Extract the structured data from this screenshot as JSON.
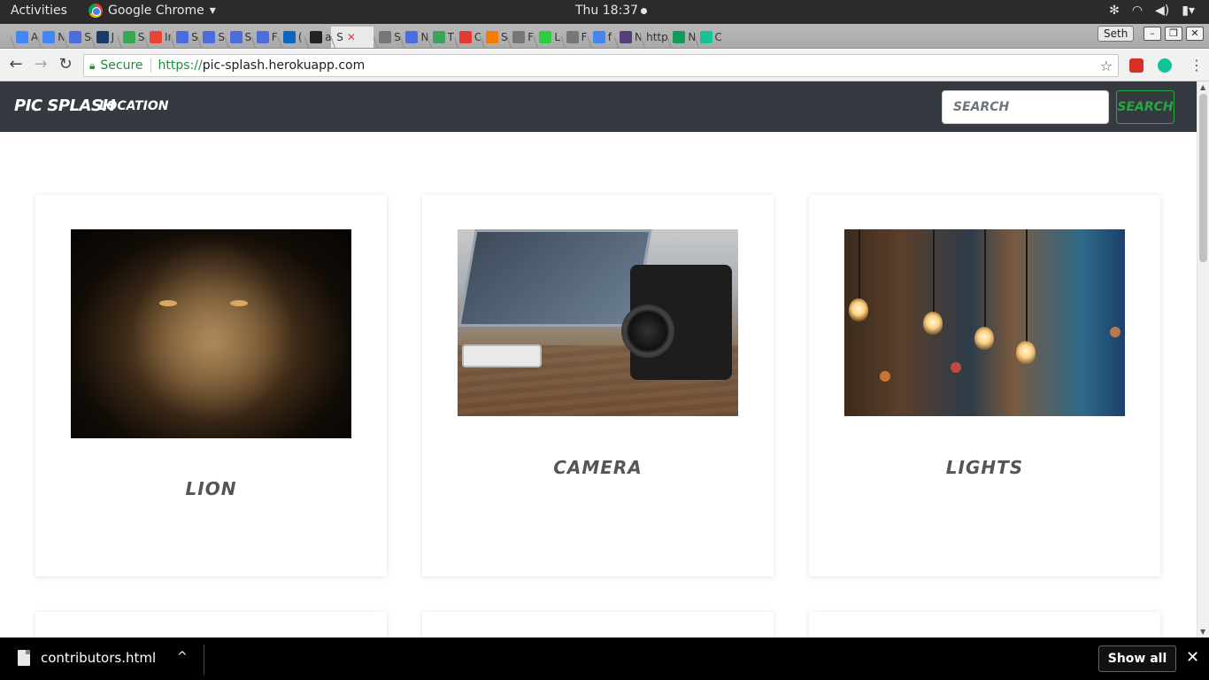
{
  "system_bar": {
    "activities": "Activities",
    "app_name": "Google Chrome",
    "clock": "Thu 18:37",
    "icons": [
      "settings-icon",
      "wifi-icon",
      "volume-icon",
      "battery-icon"
    ]
  },
  "tab_strip": {
    "tabs": [
      {
        "label": "A",
        "icon": "loading-icon",
        "color": "#4285f4"
      },
      {
        "label": "N",
        "icon": "loading-icon",
        "color": "#4285f4"
      },
      {
        "label": "S",
        "icon": "docs-icon",
        "color": "#4a6ee0"
      },
      {
        "label": "J",
        "icon": "star-icon",
        "color": "#1a3a6a"
      },
      {
        "label": "S",
        "icon": "phone-icon",
        "color": "#34a853"
      },
      {
        "label": "In",
        "icon": "gmail-icon",
        "color": "#ea4335"
      },
      {
        "label": "S",
        "icon": "docs-icon",
        "color": "#4a6ee0"
      },
      {
        "label": "S",
        "icon": "docs-icon",
        "color": "#4a6ee0"
      },
      {
        "label": "S",
        "icon": "docs-icon",
        "color": "#4a6ee0"
      },
      {
        "label": "F",
        "icon": "docs-icon",
        "color": "#4a6ee0"
      },
      {
        "label": "(",
        "icon": "linkedin-icon",
        "color": "#0a66c2"
      },
      {
        "label": "a",
        "icon": "github-icon",
        "color": "#222222"
      },
      {
        "label": "S",
        "icon": "close-icon",
        "color": "#e04040",
        "active": true
      },
      {
        "label": "S",
        "icon": "page-icon",
        "color": "#777777"
      },
      {
        "label": "N",
        "icon": "docs-icon",
        "color": "#4a6ee0"
      },
      {
        "label": "T",
        "icon": "chart-icon",
        "color": "#3ba55c"
      },
      {
        "label": "C",
        "icon": "f-icon",
        "color": "#e53935"
      },
      {
        "label": "S",
        "icon": "at-icon",
        "color": "#f57c00"
      },
      {
        "label": "F",
        "icon": "page-icon",
        "color": "#777777"
      },
      {
        "label": "L",
        "icon": "px-icon",
        "color": "#2ecc40"
      },
      {
        "label": "F",
        "icon": "page-icon",
        "color": "#777777"
      },
      {
        "label": "f",
        "icon": "google-icon",
        "color": "#4285f4"
      },
      {
        "label": "N",
        "icon": "bootstrap-icon",
        "color": "#563d7c"
      },
      {
        "label": "http",
        "icon": "none",
        "color": "#aaaaaa"
      },
      {
        "label": "N",
        "icon": "drive-icon",
        "color": "#0f9d58"
      },
      {
        "label": "C",
        "icon": "grammarly-icon",
        "color": "#15c39a"
      }
    ],
    "profile": "Seth",
    "window_buttons": [
      "minimize",
      "restore",
      "close"
    ]
  },
  "toolbar": {
    "secure_label": "Secure",
    "url_scheme": "https://",
    "url_host": "pic-splash.herokuapp.com"
  },
  "site": {
    "brand": "PIC SPLASH",
    "nav_location": "LOCATION",
    "search_placeholder": "SEARCH",
    "search_button": "SEARCH",
    "accent_color": "#28a745",
    "navbar_color": "#343a40"
  },
  "cards": [
    {
      "title": "LION",
      "image": "lion-photo"
    },
    {
      "title": "CAMERA",
      "image": "camera-photo"
    },
    {
      "title": "LIGHTS",
      "image": "lights-photo"
    }
  ],
  "downloads": {
    "filename": "contributors.html",
    "show_all": "Show all"
  }
}
